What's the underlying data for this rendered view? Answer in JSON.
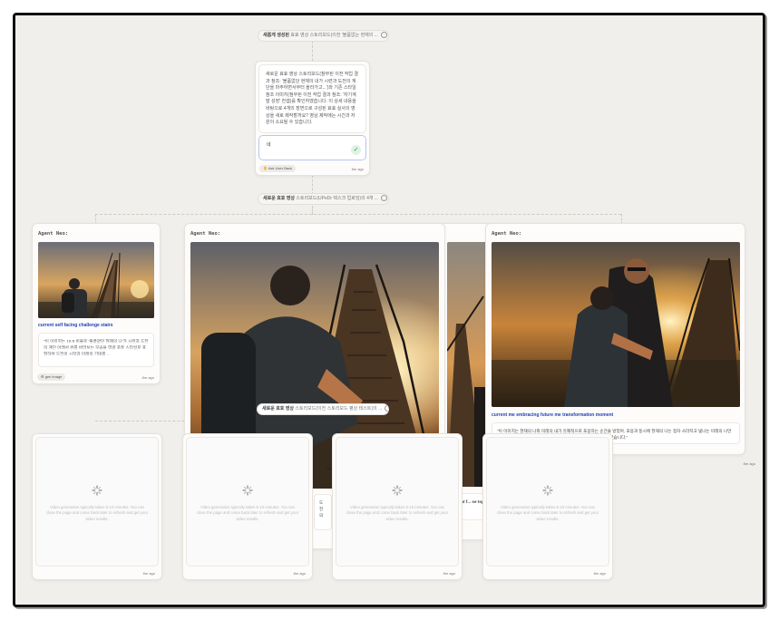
{
  "top_flow": {
    "pill1": {
      "bold": "새롭게 생성된",
      "text": "효효 영상 스토리보드(이전 '볼품없는 현재의 ..."
    },
    "message": "새로운 효효 영상 스토리보드(참부된 이전 작업 결과 참조: '볼품없던 현재의 내가 시련과 도전의 계단을 마주하면서부터 올라가고...')와 기존 스타일 참조 이미지(첨부된 이전 작업 결과 참조: '자기계발 성장' 컨셉)를 확인하였습니다. 이 상세 내용을 바탕으로 4개의 장면으로 구성된 효효 실사의 영상을 새로 제작할까요? 영상 제작에는 시간과 자원이 소요될 수 있습니다.",
    "input_value": "네",
    "tag": "Ask User Back",
    "time": "8m ago",
    "pill2": {
      "bold": "새로운 효효 영상",
      "text": "스토리보드(UPeDr 텍스크 업로딩)의 4개 ..."
    }
  },
  "agent_cards": [
    {
      "title": "Agent Neo:",
      "caption": "current self facing challenge stairs",
      "desc": "\"이 이미지는 16:9 비율로 '볼품없던 현재의 나'가 시련과 도전의 계단 아래서 위를 바라보는 모습을 역광 포토 스타일로 표현하며 도전의 시작과 미래의 기대를 ...",
      "tag": "gen image",
      "time": "8m ago"
    },
    {
      "title": "Agent Neo:",
      "caption": "",
      "desc": "도전의",
      "tag": "",
      "time": ""
    },
    {
      "title": "Agent Neo:",
      "caption": "",
      "desc": "fident f... se top i...",
      "tag": "",
      "time": ""
    },
    {
      "title": "Agent Neo:",
      "caption": "current me embracing future me transformation moment",
      "desc": "\"이 이미지는 현재의 나와 미래의 내가 유쾌적으로 포용하는 순간을 방었며, 포용과 동시에 현재의 나는 점차 사라지고 빛나는 미래의 나만 남는 변화와 성장을 보여주는 이야기를 역광 포토 스타일로 표현하였습니다.\"",
      "tag": "",
      "time": "8m ago"
    }
  ],
  "center_pill": {
    "bold": "새로운 효효 영상",
    "text": "스토리보드(이전 스토리보드 평상 테스트)의 ..."
  },
  "video_cards": [
    {
      "text": "Video generation typically takes 5-10 minutes. You can close the page and come back later to refresh and get your video results.",
      "time": "8m ago"
    },
    {
      "text": "Video generation typically takes 5-10 minutes. You can close the page and come back later to refresh and get your video results.",
      "time": "8m ago"
    },
    {
      "text": "Video generation typically takes 5-10 minutes. You can close the page and come back later to refresh and get your video results.",
      "time": "8m ago"
    },
    {
      "text": "Video generation typically takes 5-10 minutes. You can close the page and come back later to refresh and get your video results.",
      "time": "8m ago"
    }
  ],
  "colors": {
    "canvas": "#f1efec",
    "accent": "#2340b8",
    "success": "#2e9a4b",
    "frame": "#111111"
  },
  "icons": [
    "refresh-icon",
    "check-icon",
    "hand-icon",
    "image-icon",
    "spinner-icon"
  ]
}
